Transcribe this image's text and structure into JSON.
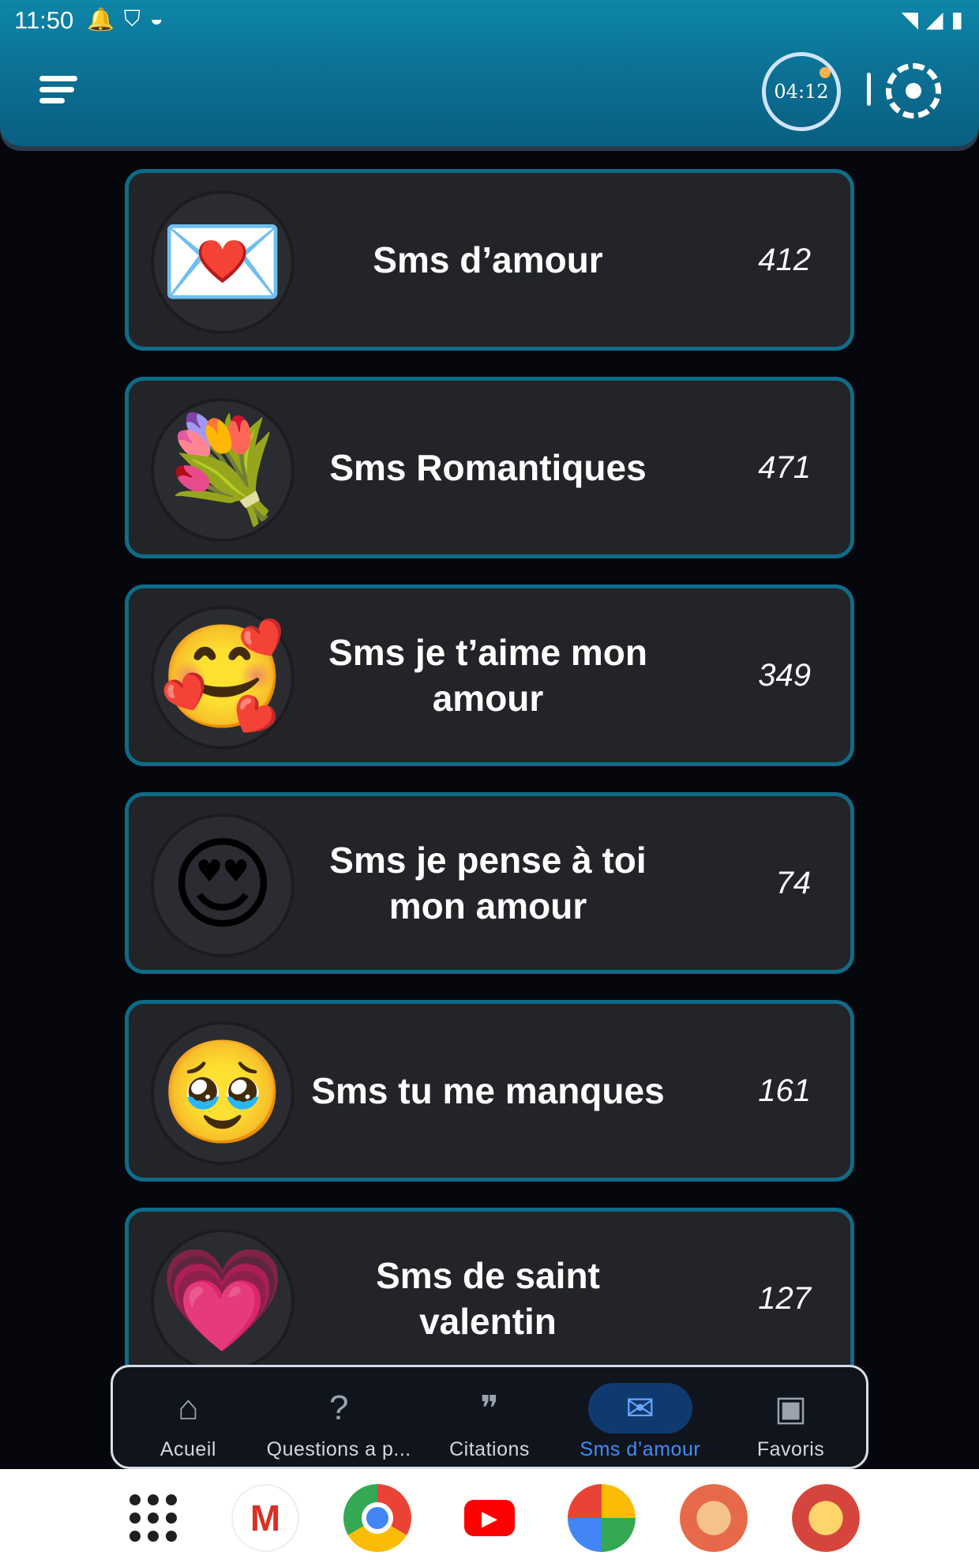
{
  "status_bar": {
    "time": "11:50",
    "left_icons": [
      "notification-icon",
      "shield-icon",
      "circle-icon"
    ],
    "right_icons": [
      "wifi-icon",
      "signal-icon",
      "battery-icon"
    ]
  },
  "header": {
    "timer_value": "04:12"
  },
  "categories": [
    {
      "title": "Sms d’amour",
      "count": "412",
      "icon": "love-letter-icon",
      "emoji": "💌"
    },
    {
      "title": "Sms Romantiques",
      "count": "471",
      "icon": "bouquet-icon",
      "emoji": "💐"
    },
    {
      "title": "Sms je t’aime mon amour",
      "count": "349",
      "icon": "smiling-face-with-hearts-icon",
      "emoji": "🥰"
    },
    {
      "title": "Sms je pense à toi mon amour",
      "count": "74",
      "icon": "heart-eyes-icon",
      "emoji": "😍"
    },
    {
      "title": "Sms tu me manques",
      "count": "161",
      "icon": "holding-back-tears-icon",
      "emoji": "🥹"
    },
    {
      "title": "Sms de saint valentin",
      "count": "127",
      "icon": "heart-icon",
      "emoji": "💗"
    }
  ],
  "bottom_nav": [
    {
      "label": "Acueil",
      "icon": "home-icon",
      "glyph": "⌂",
      "active": false
    },
    {
      "label": "Questions a p...",
      "icon": "question-icon",
      "glyph": "?",
      "active": false
    },
    {
      "label": "Citations",
      "icon": "quote-icon",
      "glyph": "❞",
      "active": false
    },
    {
      "label": "Sms d’amour",
      "icon": "mail-icon",
      "glyph": "✉",
      "active": true
    },
    {
      "label": "Favoris",
      "icon": "library-icon",
      "glyph": "▣",
      "active": false
    }
  ],
  "dock": {
    "apps": [
      "app-drawer-icon",
      "gmail-icon",
      "chrome-icon",
      "youtube-icon",
      "photos-icon",
      "app-icon-1",
      "app-icon-2"
    ],
    "gmail_glyph": "M",
    "youtube_glyph": "▶"
  },
  "colors": {
    "header": "#0b7499",
    "card_border": "#0f6b87",
    "card_bg": "#222428",
    "active_nav": "#3f8dff"
  }
}
